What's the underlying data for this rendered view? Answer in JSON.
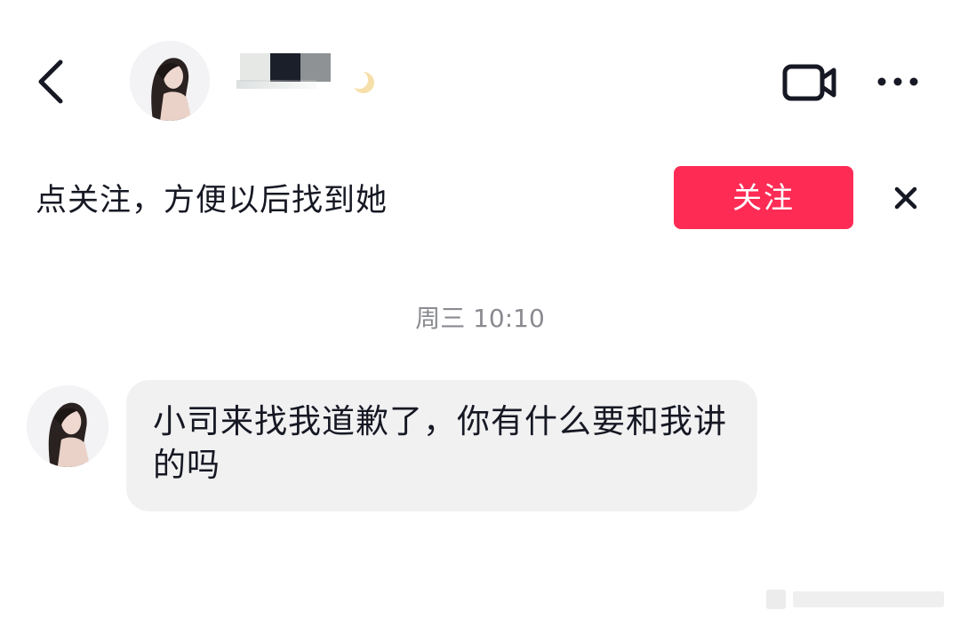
{
  "header": {
    "contact_name": "",
    "back_icon": "chevron-left-icon",
    "video_icon": "video-camera-icon",
    "more_icon": "more-horizontal-icon"
  },
  "follow_bar": {
    "tip": "点关注，方便以后找到她",
    "follow_label": "关注",
    "close_icon": "close-icon",
    "accent_color": "#fe2c55"
  },
  "chat": {
    "timestamp": "周三 10:10",
    "messages": [
      {
        "from": "contact",
        "text": "小司来找我道歉了，你有什么要和我讲的吗"
      }
    ]
  }
}
